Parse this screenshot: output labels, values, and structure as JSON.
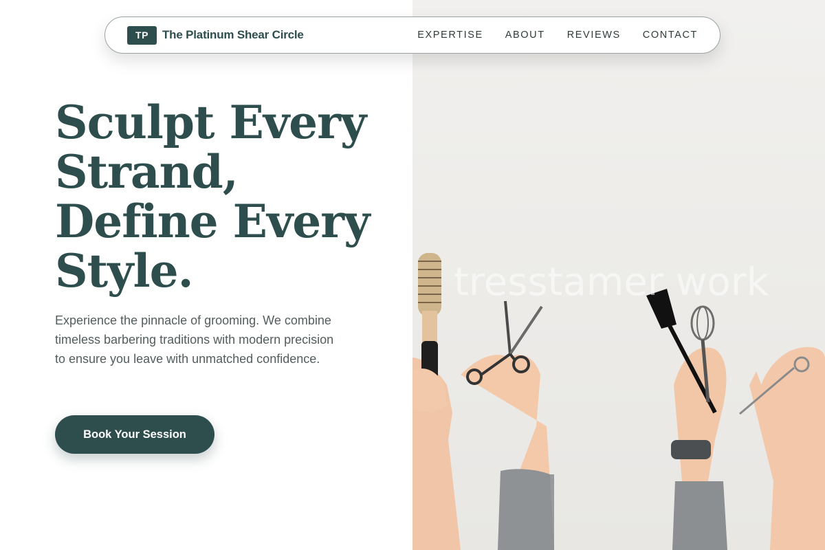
{
  "header": {
    "logo_initials": "TP",
    "brand_name": "The Platinum Shear Circle",
    "nav": [
      {
        "label": "EXPERTISE"
      },
      {
        "label": "ABOUT"
      },
      {
        "label": "REVIEWS"
      },
      {
        "label": "CONTACT"
      }
    ]
  },
  "hero": {
    "headline_lines": [
      "Sculpt Every",
      "Strand,",
      "Define Every",
      "Style."
    ],
    "subtext": "Experience the pinnacle of grooming. We combine timeless barbering traditions with modern precision to ensure you leave with unmatched confidence.",
    "cta_label": "Book Your Session",
    "image_watermark": "tresstamer work"
  },
  "colors": {
    "primary": "#2e4e4e",
    "text_muted": "#535d5d",
    "background": "#ffffff",
    "photo_background": "#eeedeb"
  },
  "icons": {
    "logo": "tp-monogram-badge",
    "photo": "hands-holding-barber-tools"
  }
}
